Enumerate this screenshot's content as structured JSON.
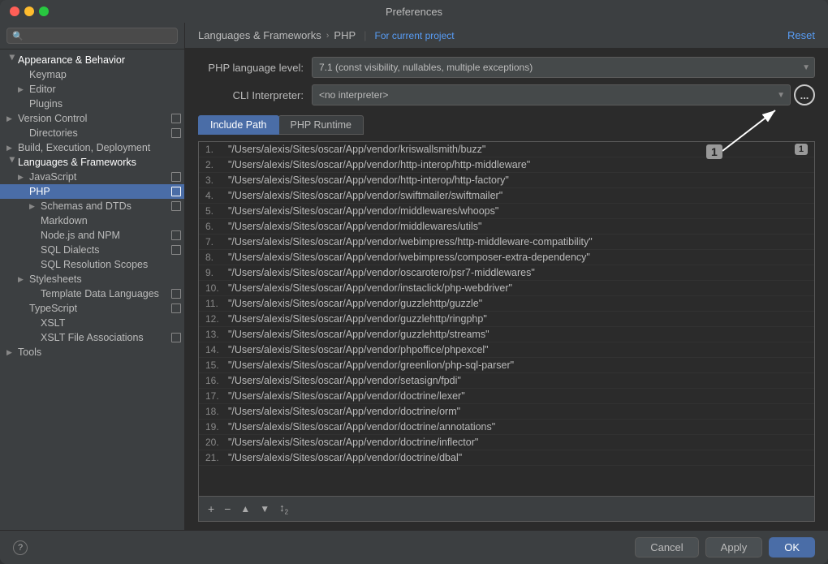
{
  "window": {
    "title": "Preferences"
  },
  "search": {
    "placeholder": "🔍"
  },
  "sidebar": {
    "items": [
      {
        "id": "appearance-behavior",
        "label": "Appearance & Behavior",
        "level": 0,
        "expanded": true,
        "hasArrow": true
      },
      {
        "id": "keymap",
        "label": "Keymap",
        "level": 1,
        "hasArrow": false
      },
      {
        "id": "editor",
        "label": "Editor",
        "level": 1,
        "hasArrow": true,
        "collapsed": true
      },
      {
        "id": "plugins",
        "label": "Plugins",
        "level": 1,
        "hasArrow": false
      },
      {
        "id": "version-control",
        "label": "Version Control",
        "level": 0,
        "hasArrow": true,
        "hasRepo": true
      },
      {
        "id": "directories",
        "label": "Directories",
        "level": 1,
        "hasArrow": false,
        "hasRepo": true
      },
      {
        "id": "build-execution",
        "label": "Build, Execution, Deployment",
        "level": 0,
        "hasArrow": true
      },
      {
        "id": "languages-frameworks",
        "label": "Languages & Frameworks",
        "level": 0,
        "hasArrow": true,
        "expanded": true
      },
      {
        "id": "javascript",
        "label": "JavaScript",
        "level": 1,
        "hasArrow": true,
        "collapsed": true,
        "hasRepo": true
      },
      {
        "id": "php",
        "label": "PHP",
        "level": 1,
        "hasArrow": false,
        "selected": true,
        "hasRepo": true
      },
      {
        "id": "schemas-dtds",
        "label": "Schemas and DTDs",
        "level": 2,
        "hasArrow": true,
        "collapsed": true,
        "hasRepo": true
      },
      {
        "id": "markdown",
        "label": "Markdown",
        "level": 2,
        "hasArrow": false
      },
      {
        "id": "nodejs-npm",
        "label": "Node.js and NPM",
        "level": 2,
        "hasArrow": false,
        "hasRepo": true
      },
      {
        "id": "sql-dialects",
        "label": "SQL Dialects",
        "level": 2,
        "hasArrow": false,
        "hasRepo": true
      },
      {
        "id": "sql-resolution",
        "label": "SQL Resolution Scopes",
        "level": 2,
        "hasArrow": false
      },
      {
        "id": "stylesheets",
        "label": "Stylesheets",
        "level": 1,
        "hasArrow": true,
        "collapsed": true
      },
      {
        "id": "template-data",
        "label": "Template Data Languages",
        "level": 2,
        "hasArrow": false,
        "hasRepo": true
      },
      {
        "id": "typescript",
        "label": "TypeScript",
        "level": 1,
        "hasArrow": false,
        "hasRepo": true
      },
      {
        "id": "xslt",
        "label": "XSLT",
        "level": 2,
        "hasArrow": false
      },
      {
        "id": "xslt-file",
        "label": "XSLT File Associations",
        "level": 2,
        "hasArrow": false,
        "hasRepo": true
      },
      {
        "id": "tools",
        "label": "Tools",
        "level": 0,
        "hasArrow": true,
        "collapsed": true
      }
    ]
  },
  "header": {
    "breadcrumb1": "Languages & Frameworks",
    "breadcrumb_arrow": "›",
    "breadcrumb2": "PHP",
    "project_link": "For current project",
    "reset_label": "Reset"
  },
  "php_form": {
    "lang_label": "PHP language level:",
    "lang_value": "7.1 (const visibility, nullables, multiple exceptions)",
    "cli_label": "CLI Interpreter:",
    "cli_value": "<no interpreter>"
  },
  "tabs": [
    {
      "id": "include-path",
      "label": "Include Path",
      "active": true
    },
    {
      "id": "php-runtime",
      "label": "PHP Runtime",
      "active": false
    }
  ],
  "paths": [
    {
      "num": "1.",
      "path": "\"/Users/alexis/Sites/oscar/App/vendor/kriswallsmith/buzz\""
    },
    {
      "num": "2.",
      "path": "\"/Users/alexis/Sites/oscar/App/vendor/http-interop/http-middleware\""
    },
    {
      "num": "3.",
      "path": "\"/Users/alexis/Sites/oscar/App/vendor/http-interop/http-factory\""
    },
    {
      "num": "4.",
      "path": "\"/Users/alexis/Sites/oscar/App/vendor/swiftmailer/swiftmailer\""
    },
    {
      "num": "5.",
      "path": "\"/Users/alexis/Sites/oscar/App/vendor/middlewares/whoops\""
    },
    {
      "num": "6.",
      "path": "\"/Users/alexis/Sites/oscar/App/vendor/middlewares/utils\""
    },
    {
      "num": "7.",
      "path": "\"/Users/alexis/Sites/oscar/App/vendor/webimpress/http-middleware-compatibility\""
    },
    {
      "num": "8.",
      "path": "\"/Users/alexis/Sites/oscar/App/vendor/webimpress/composer-extra-dependency\""
    },
    {
      "num": "9.",
      "path": "\"/Users/alexis/Sites/oscar/App/vendor/oscarotero/psr7-middlewares\""
    },
    {
      "num": "10.",
      "path": "\"/Users/alexis/Sites/oscar/App/vendor/instaclick/php-webdriver\""
    },
    {
      "num": "11.",
      "path": "\"/Users/alexis/Sites/oscar/App/vendor/guzzlehttp/guzzle\""
    },
    {
      "num": "12.",
      "path": "\"/Users/alexis/Sites/oscar/App/vendor/guzzlehttp/ringphp\""
    },
    {
      "num": "13.",
      "path": "\"/Users/alexis/Sites/oscar/App/vendor/guzzlehttp/streams\""
    },
    {
      "num": "14.",
      "path": "\"/Users/alexis/Sites/oscar/App/vendor/phpoffice/phpexcel\""
    },
    {
      "num": "15.",
      "path": "\"/Users/alexis/Sites/oscar/App/vendor/greenlion/php-sql-parser\""
    },
    {
      "num": "16.",
      "path": "\"/Users/alexis/Sites/oscar/App/vendor/setasign/fpdi\""
    },
    {
      "num": "17.",
      "path": "\"/Users/alexis/Sites/oscar/App/vendor/doctrine/lexer\""
    },
    {
      "num": "18.",
      "path": "\"/Users/alexis/Sites/oscar/App/vendor/doctrine/orm\""
    },
    {
      "num": "19.",
      "path": "\"/Users/alexis/Sites/oscar/App/vendor/doctrine/annotations\""
    },
    {
      "num": "20.",
      "path": "\"/Users/alexis/Sites/oscar/App/vendor/doctrine/inflector\""
    },
    {
      "num": "21.",
      "path": "\"/Users/alexis/Sites/oscar/App/vendor/doctrine/dbal\""
    }
  ],
  "toolbar": {
    "add": "+",
    "remove": "−",
    "up": "▲",
    "down": "▼",
    "config": "⚙"
  },
  "footer": {
    "cancel_label": "Cancel",
    "apply_label": "Apply",
    "ok_label": "OK"
  },
  "annotation": {
    "badge": "1"
  }
}
